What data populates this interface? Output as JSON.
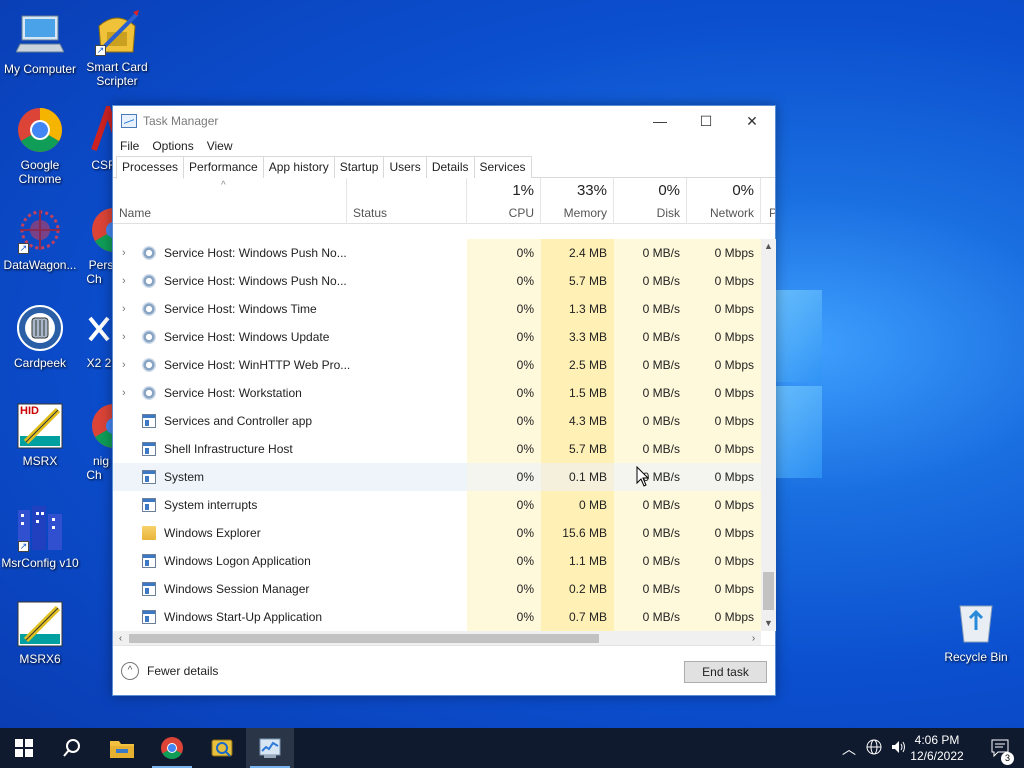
{
  "desktop": {
    "icons": [
      {
        "label": "My Computer",
        "icon": "computer-icon"
      },
      {
        "label": "Smart Card Scripter",
        "icon": "smart-card-icon"
      },
      {
        "label": "Google Chrome",
        "icon": "chrome-icon"
      },
      {
        "label": "CSR",
        "icon": "app-icon"
      },
      {
        "label": "DataWagon...",
        "icon": "datawagon-icon"
      },
      {
        "label": "Pers Ch",
        "icon": "chrome-icon"
      },
      {
        "label": "Cardpeek",
        "icon": "cardpeek-icon"
      },
      {
        "label": "X2 2",
        "icon": "x2-icon"
      },
      {
        "label": "MSRX",
        "icon": "msrx-icon"
      },
      {
        "label": "nig Ch",
        "icon": "chrome-icon"
      },
      {
        "label": "MsrConfig v10",
        "icon": "msrconfig-icon"
      },
      {
        "label": "MSRX6",
        "icon": "msrx6-icon"
      },
      {
        "label": "Recycle Bin",
        "icon": "recycle-bin-icon"
      }
    ],
    "hid_text": "HID"
  },
  "window": {
    "title": "Task Manager",
    "controls": {
      "minimize": "—",
      "maximize": "☐",
      "close": "✕"
    },
    "menu": [
      "File",
      "Options",
      "View"
    ],
    "tabs": [
      "Processes",
      "Performance",
      "App history",
      "Startup",
      "Users",
      "Details",
      "Services"
    ],
    "active_tab": "Processes"
  },
  "columns": {
    "name": "Name",
    "status": "Status",
    "cpu": {
      "pct": "1%",
      "label": "CPU"
    },
    "memory": {
      "pct": "33%",
      "label": "Memory"
    },
    "disk": {
      "pct": "0%",
      "label": "Disk"
    },
    "network": {
      "pct": "0%",
      "label": "Network"
    },
    "partial": "P"
  },
  "processes": [
    {
      "name": "Service Host: Windows Push No...",
      "expand": true,
      "icon": "gear",
      "cpu": "0%",
      "memory": "2.4 MB",
      "disk": "0 MB/s",
      "network": "0 Mbps"
    },
    {
      "name": "Service Host: Windows Push No...",
      "expand": true,
      "icon": "gear",
      "cpu": "0%",
      "memory": "5.7 MB",
      "disk": "0 MB/s",
      "network": "0 Mbps"
    },
    {
      "name": "Service Host: Windows Time",
      "expand": true,
      "icon": "gear",
      "cpu": "0%",
      "memory": "1.3 MB",
      "disk": "0 MB/s",
      "network": "0 Mbps"
    },
    {
      "name": "Service Host: Windows Update",
      "expand": true,
      "icon": "gear",
      "cpu": "0%",
      "memory": "3.3 MB",
      "disk": "0 MB/s",
      "network": "0 Mbps"
    },
    {
      "name": "Service Host: WinHTTP Web Pro...",
      "expand": true,
      "icon": "gear",
      "cpu": "0%",
      "memory": "2.5 MB",
      "disk": "0 MB/s",
      "network": "0 Mbps"
    },
    {
      "name": "Service Host: Workstation",
      "expand": true,
      "icon": "gear",
      "cpu": "0%",
      "memory": "1.5 MB",
      "disk": "0 MB/s",
      "network": "0 Mbps"
    },
    {
      "name": "Services and Controller app",
      "expand": false,
      "icon": "appwin",
      "cpu": "0%",
      "memory": "4.3 MB",
      "disk": "0 MB/s",
      "network": "0 Mbps"
    },
    {
      "name": "Shell Infrastructure Host",
      "expand": false,
      "icon": "appwin",
      "cpu": "0%",
      "memory": "5.7 MB",
      "disk": "0 MB/s",
      "network": "0 Mbps"
    },
    {
      "name": "System",
      "expand": false,
      "icon": "appwin",
      "cpu": "0%",
      "memory": "0.1 MB",
      "disk": "0 MB/s",
      "network": "0 Mbps",
      "highlight": true
    },
    {
      "name": "System interrupts",
      "expand": false,
      "icon": "appwin",
      "cpu": "0%",
      "memory": "0 MB",
      "disk": "0 MB/s",
      "network": "0 Mbps"
    },
    {
      "name": "Windows Explorer",
      "expand": false,
      "icon": "folder",
      "cpu": "0%",
      "memory": "15.6 MB",
      "disk": "0 MB/s",
      "network": "0 Mbps"
    },
    {
      "name": "Windows Logon Application",
      "expand": false,
      "icon": "appwin",
      "cpu": "0%",
      "memory": "1.1 MB",
      "disk": "0 MB/s",
      "network": "0 Mbps"
    },
    {
      "name": "Windows Session Manager",
      "expand": false,
      "icon": "appwin",
      "cpu": "0%",
      "memory": "0.2 MB",
      "disk": "0 MB/s",
      "network": "0 Mbps"
    },
    {
      "name": "Windows Start-Up Application",
      "expand": false,
      "icon": "appwin",
      "cpu": "0%",
      "memory": "0.7 MB",
      "disk": "0 MB/s",
      "network": "0 Mbps"
    }
  ],
  "footer": {
    "fewer_details": "Fewer details",
    "end_task": "End task"
  },
  "taskbar": {
    "pinned": [
      "start-icon",
      "search-icon",
      "file-explorer-icon",
      "chrome-icon",
      "smart-card-icon",
      "task-manager-icon"
    ],
    "time": "4:06 PM",
    "date": "12/6/2022",
    "notification_count": "3"
  }
}
